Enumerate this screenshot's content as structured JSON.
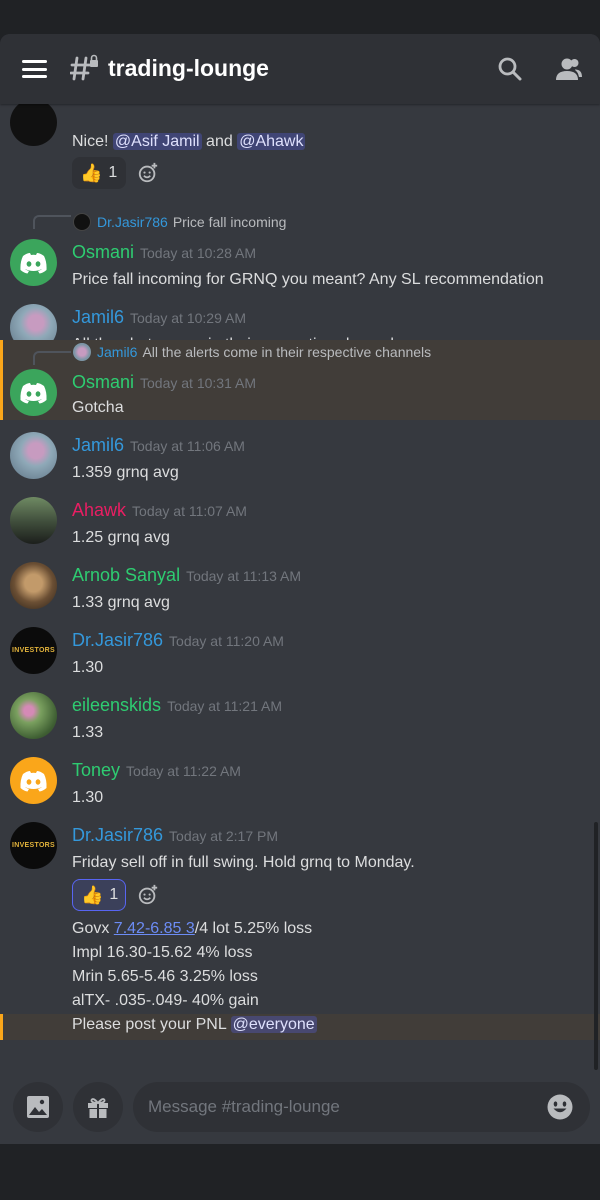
{
  "header": {
    "title": "trading-lounge"
  },
  "messages": {
    "top": {
      "text_prefix": "Nice! ",
      "mention1": "@Asif Jamil",
      "and": " and ",
      "mention2": "@Ahawk",
      "reaction_count": "1"
    },
    "m1": {
      "reply_name": "Dr.Jasir786",
      "reply_text": "Price fall incoming",
      "name": "Osmani",
      "time": "Today at 10:28 AM",
      "text": "Price fall incoming for GRNQ you meant? Any SL recommendation"
    },
    "m2": {
      "name": "Jamil6",
      "time": "Today at 10:29 AM",
      "text": "All the alerts come in their respective channels"
    },
    "m3": {
      "reply_name": "Jamil6",
      "reply_text": "All the alerts come in their respective channels",
      "name": "Osmani",
      "time": "Today at 10:31 AM",
      "text": "Gotcha"
    },
    "m4": {
      "name": "Jamil6",
      "time": "Today at 11:06 AM",
      "text": "1.359 grnq avg"
    },
    "m5": {
      "name": "Ahawk",
      "time": "Today at 11:07 AM",
      "text": "1.25 grnq avg"
    },
    "m6": {
      "name": "Arnob Sanyal",
      "time": "Today at 11:13 AM",
      "text": "1.33 grnq avg"
    },
    "m7": {
      "name": "Dr.Jasir786",
      "time": "Today at 11:20 AM",
      "text": "1.30",
      "avatar_text": "INVESTORS"
    },
    "m8": {
      "name": "eileenskids",
      "time": "Today at 11:21 AM",
      "text": "1.33"
    },
    "m9": {
      "name": "Toney",
      "time": "Today at 11:22 AM",
      "text": "1.30"
    },
    "m10": {
      "name": "Dr.Jasir786",
      "time": "Today at 2:17 PM",
      "avatar_text": "INVESTORS",
      "text": "Friday sell off in full swing. Hold grnq to Monday.",
      "reaction_count": "1",
      "line1_prefix": "Govx ",
      "line1_link": "7.42-6.85 3",
      "line1_suffix": "/4 lot 5.25% loss",
      "line2": "Impl 16.30-15.62 4% loss",
      "line3": "Mrin 5.65-5.46 3.25% loss",
      "line4": "alTX- .035-.049- 40% gain",
      "line5_prefix": "Please post your PNL ",
      "line5_mention": "@everyone"
    }
  },
  "composer": {
    "placeholder": "Message #trading-lounge"
  },
  "colors": {
    "accent": "#5865f2",
    "background": "#36393f",
    "highlight": "#faa61a"
  }
}
